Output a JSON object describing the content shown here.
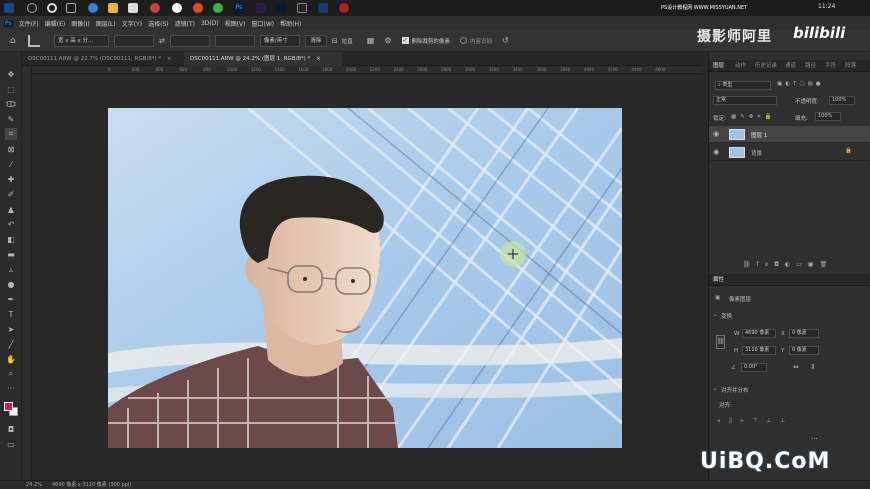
{
  "taskbar": {
    "ps_label": "Ps",
    "clock": "11:24",
    "watermark_site": "PS设计教程网  WWW.MISSYUAN.NET"
  },
  "menu": {
    "items": [
      "文件(F)",
      "编辑(E)",
      "图像(I)",
      "图层(L)",
      "文字(Y)",
      "选择(S)",
      "滤镜(T)",
      "3D(D)",
      "视图(V)",
      "窗口(W)",
      "帮助(H)"
    ]
  },
  "options": {
    "ratio": "宽 x 高 x 分...",
    "unit": "像素/英寸",
    "clear": "清除",
    "straighten": "拉直",
    "delete_cropped": "删除裁剪的像素",
    "content_aware": "内容识别"
  },
  "watermark": {
    "bilibili_name": "摄影师阿里",
    "bilibili_logo": "bilibili",
    "uibq": "UiBQ.CoM"
  },
  "doc_tabs": [
    {
      "label": "DSC00111.ARW @ 22.7% (DSC00111, RGB/8*) *",
      "close": "×"
    },
    {
      "label": "DSC00111.ARW @ 24.2% (图层 1, RGB/8*) *",
      "close": "×"
    }
  ],
  "ruler_marks": [
    "0",
    "200",
    "400",
    "600",
    "800",
    "1000",
    "1200",
    "1400",
    "1600",
    "1800",
    "2000",
    "2200",
    "2400",
    "2600",
    "2800",
    "3000",
    "3200",
    "3400",
    "3600",
    "3800",
    "4000",
    "4200",
    "4400",
    "4600"
  ],
  "status": {
    "zoom": "24.2%",
    "doc_info": "4690 像素 x 3110 像素 (300 ppi)"
  },
  "panels": {
    "top_tabs": [
      "图层",
      "动作",
      "历史记录",
      "通道",
      "路径",
      "字符",
      "段落"
    ],
    "kind": "类型",
    "blend_mode": "正常",
    "opacity_label": "不透明度:",
    "opacity": "100%",
    "lock_label": "锁定:",
    "fill_label": "填充:",
    "fill": "100%",
    "layers": [
      {
        "name": "图层 1"
      },
      {
        "name": "背景"
      }
    ],
    "properties_tab": "属性",
    "pixel_layer": "像素图层",
    "transform": "变换",
    "w_label": "W",
    "w": "4690 像素",
    "x_label": "X",
    "x": "0 像素",
    "h_label": "H",
    "h": "3110 像素",
    "y_label": "Y",
    "y": "0 像素",
    "angle": "0.00°",
    "align_section": "对齐并分布",
    "align_label": "对齐:",
    "more": "..."
  },
  "colors": {
    "fg_color": "#e0145a",
    "bg_color": "#ffffff",
    "ps_blue": "#31a8ff"
  }
}
